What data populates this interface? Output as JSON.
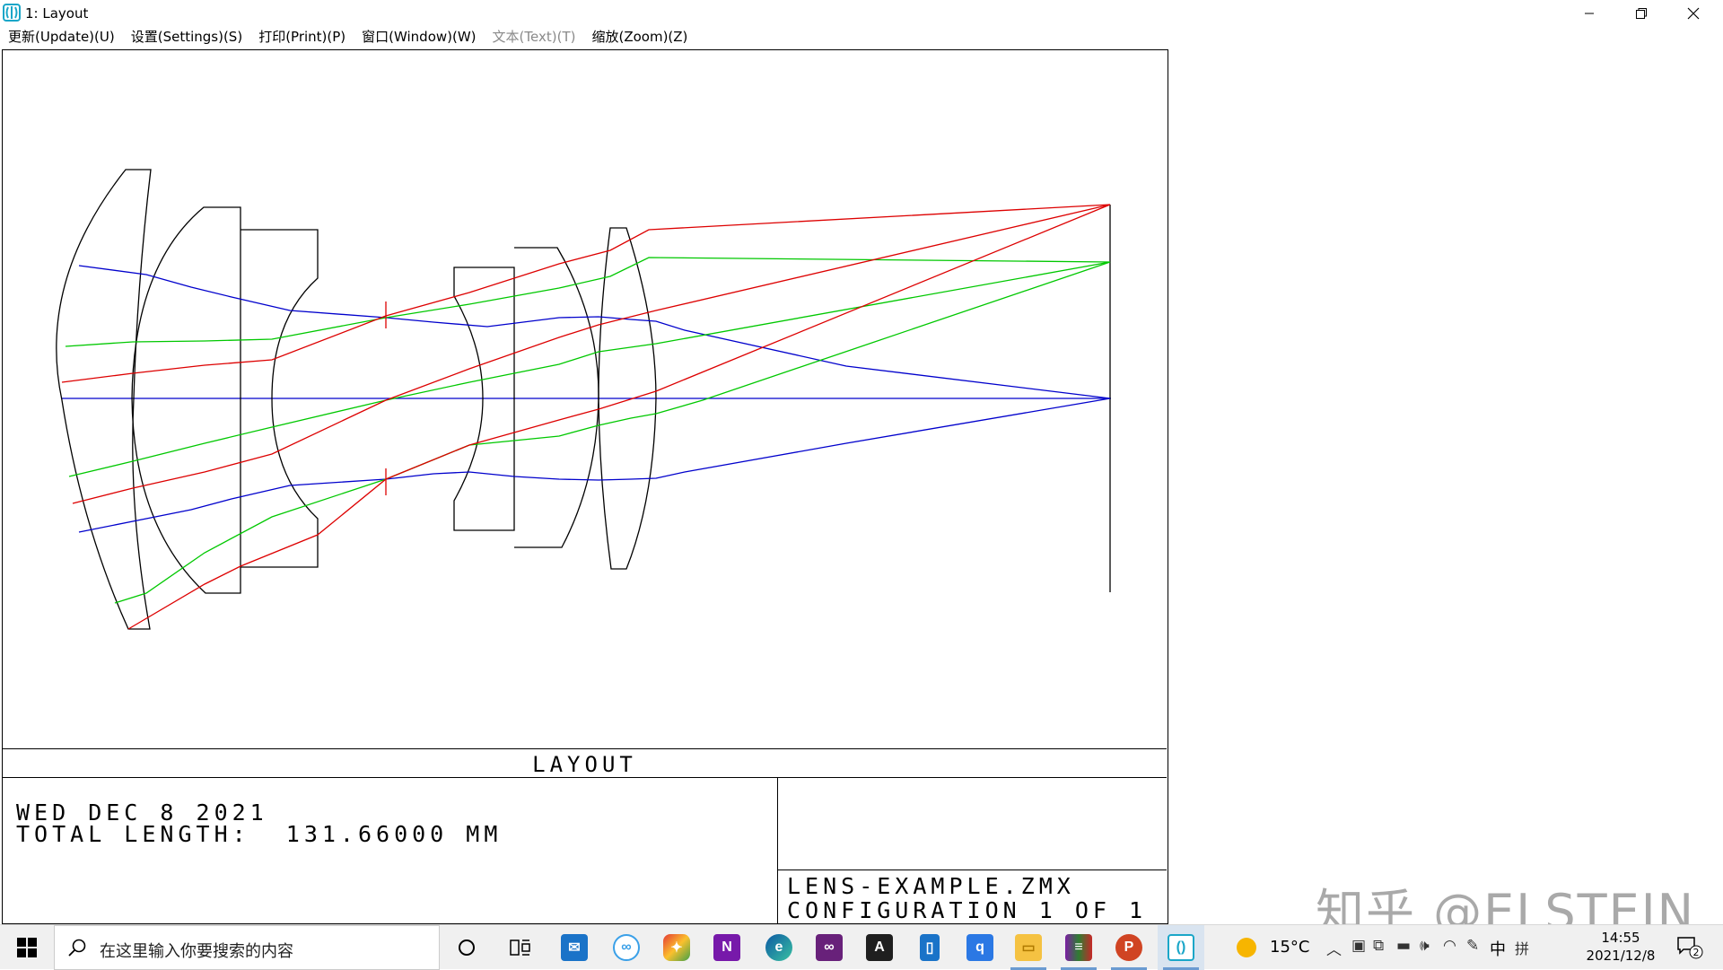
{
  "window": {
    "title": "1: Layout",
    "menu": [
      {
        "label": "更新(Update)(U)",
        "enabled": true
      },
      {
        "label": "设置(Settings)(S)",
        "enabled": true
      },
      {
        "label": "打印(Print)(P)",
        "enabled": true
      },
      {
        "label": "窗口(Window)(W)",
        "enabled": true
      },
      {
        "label": "文本(Text)(T)",
        "enabled": false
      },
      {
        "label": "缩放(Zoom)(Z)",
        "enabled": true
      }
    ]
  },
  "layout": {
    "title": "LAYOUT",
    "date_line": "WED DEC 8 2021",
    "total_length_line": "TOTAL LENGTH:  131.66000 MM",
    "file_line": "LENS-EXAMPLE.ZMX",
    "config_line": "CONFIGURATION 1 OF 1",
    "colors": {
      "field1": "#0000cc",
      "field2": "#00c800",
      "field3": "#dd0000",
      "lens": "#000000"
    }
  },
  "watermark": "知乎 @ELSTEIN",
  "taskbar": {
    "search_placeholder": "在这里输入你要搜索的内容",
    "apps": [
      "cortana-icon",
      "task-view-icon",
      "mail-icon",
      "baidu-netdisk-icon",
      "colorful-app-icon",
      "onenote-icon",
      "edge-icon",
      "visual-studio-icon",
      "acrobat-icon",
      "phone-icon",
      "tencent-icon",
      "file-explorer-icon",
      "winrar-icon",
      "powerpoint-icon",
      "zemax-icon"
    ],
    "weather": "15°C",
    "ime_lang": "中",
    "ime_mode": "拼",
    "time": "14:55",
    "date": "2021/12/8",
    "notification_count": "2"
  }
}
